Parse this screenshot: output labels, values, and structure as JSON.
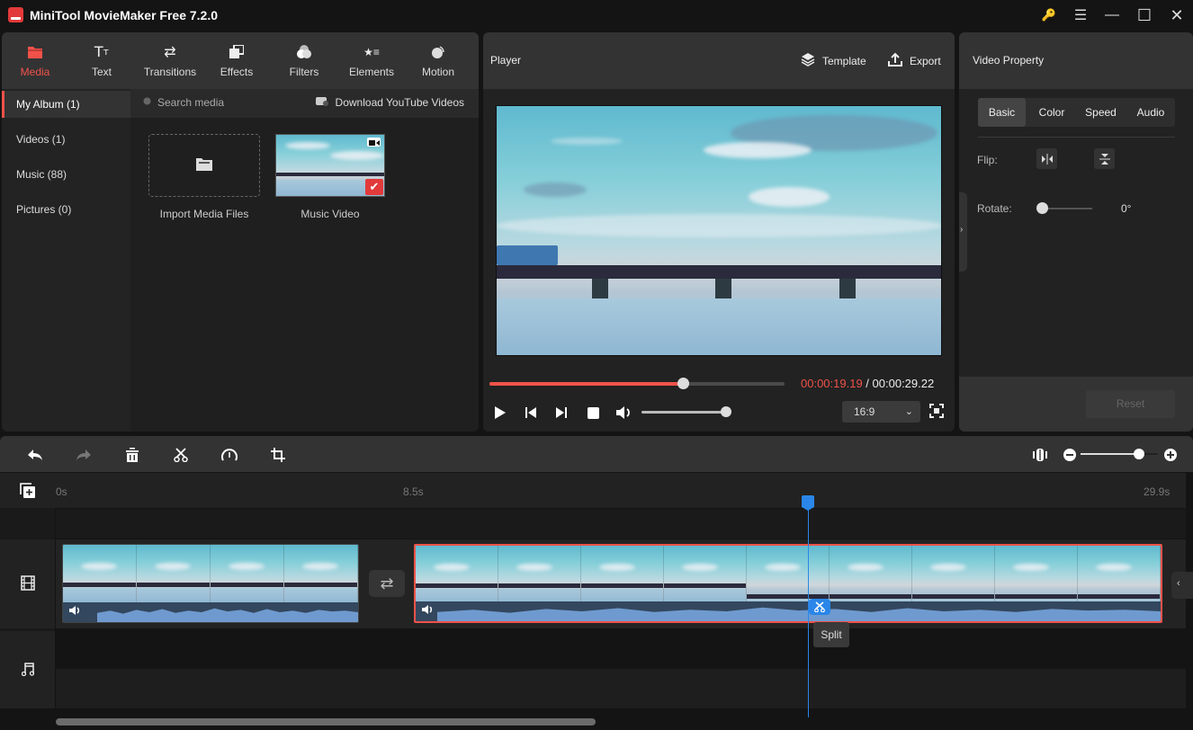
{
  "app": {
    "title": "MiniTool MovieMaker Free 7.2.0"
  },
  "window_controls": [
    {
      "name": "key-icon",
      "glyph": "🔑",
      "color": "#f0b400"
    },
    {
      "name": "menu-icon",
      "glyph": "☰"
    },
    {
      "name": "minimize-icon",
      "glyph": "—"
    },
    {
      "name": "maximize-icon",
      "glyph": "☐"
    },
    {
      "name": "close-icon",
      "glyph": "✕"
    }
  ],
  "media_tabs": [
    {
      "label": "Media",
      "icon": "folder-icon",
      "glyph": "▬",
      "active": true
    },
    {
      "label": "Text",
      "icon": "text-icon",
      "glyph": "Tт"
    },
    {
      "label": "Transitions",
      "icon": "transitions-icon",
      "glyph": "⇄"
    },
    {
      "label": "Effects",
      "icon": "effects-icon",
      "glyph": "❐"
    },
    {
      "label": "Filters",
      "icon": "filters-icon",
      "glyph": "●"
    },
    {
      "label": "Elements",
      "icon": "elements-icon",
      "glyph": "★≡"
    },
    {
      "label": "Motion",
      "icon": "motion-icon",
      "glyph": "◉"
    }
  ],
  "album": {
    "items": [
      {
        "label": "My Album (1)",
        "active": true
      },
      {
        "label": "Videos (1)"
      },
      {
        "label": "Music (88)"
      },
      {
        "label": "Pictures (0)"
      }
    ]
  },
  "media": {
    "search_placeholder": "Search media",
    "download_label": "Download YouTube Videos",
    "import_label": "Import Media Files",
    "items": [
      {
        "label": "Music Video",
        "selected": true
      }
    ]
  },
  "player": {
    "title": "Player",
    "template_label": "Template",
    "export_label": "Export",
    "current_time": "00:00:19.19",
    "separator": " / ",
    "total_time": "00:00:29.22",
    "progress_fraction": 0.657,
    "volume_fraction": 1.0,
    "aspect_ratio": "16:9",
    "accent_color": "#f0524a"
  },
  "property": {
    "title": "Video Property",
    "tabs": [
      {
        "label": "Basic",
        "active": true
      },
      {
        "label": "Color"
      },
      {
        "label": "Speed"
      },
      {
        "label": "Audio"
      }
    ],
    "flip_label": "Flip:",
    "rotate_label": "Rotate:",
    "rotate_value": "0°",
    "reset_label": "Reset"
  },
  "timeline": {
    "toolbar": [
      "undo",
      "redo",
      "delete",
      "split",
      "speed",
      "crop"
    ],
    "ruler": [
      "0s",
      "8.5s",
      "29.9s"
    ],
    "zoom_fraction": 0.76,
    "split_tooltip": "Split",
    "playhead_color": "#2a86e8"
  }
}
